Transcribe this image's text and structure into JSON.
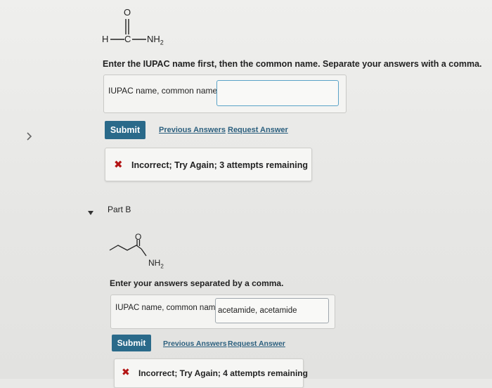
{
  "nav": {
    "chevron": "chevron-right-icon"
  },
  "part_a": {
    "molecule": {
      "top_atom": "O",
      "left_atom": "H",
      "center_atom": "C",
      "right_group": "NH",
      "right_sub": "2"
    },
    "instruction": "Enter the IUPAC name first, then the common name. Separate your answers with a comma.",
    "field_label": "IUPAC name, common name:",
    "field_value": "",
    "submit_label": "Submit",
    "previous_answers": "Previous Answers",
    "request_answer": "Request Answer",
    "feedback": "Incorrect; Try Again; 3 attempts remaining",
    "feedback_icon": "close-icon"
  },
  "part_b": {
    "title": "Part B",
    "toggle_icon": "caret-down-icon",
    "molecule": {
      "top_atom": "O",
      "group": "NH",
      "group_sub": "2"
    },
    "instruction": "Enter your answers separated by a comma.",
    "field_label": "IUPAC name, common name",
    "field_value": "acetamide, acetamide",
    "submit_label": "Submit",
    "previous_answers": "Previous Answers",
    "request_answer": "Request Answer",
    "feedback": "Incorrect; Try Again; 4 attempts remaining",
    "feedback_icon": "close-icon"
  },
  "colors": {
    "accent": "#2a6a8a",
    "link": "#2b5f7e",
    "error": "#b31414",
    "input_border": "#5aa3c7"
  }
}
